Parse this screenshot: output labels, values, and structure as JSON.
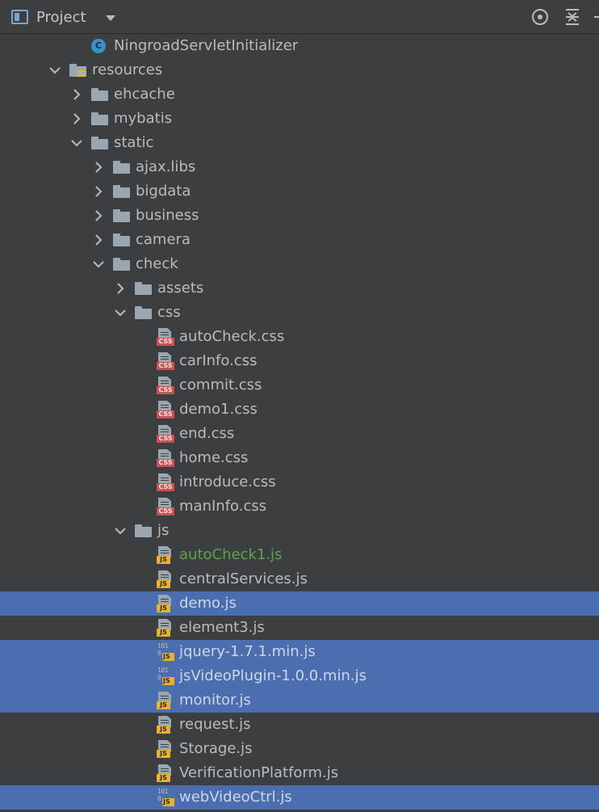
{
  "header": {
    "title": "Project",
    "locate_icon": "target-icon",
    "collapse_icon": "collapse-all-icon"
  },
  "tree": [
    {
      "label": "NingroadServletInitializer",
      "type": "class",
      "depth": 3,
      "expanded": null,
      "selected": false
    },
    {
      "label": "resources",
      "type": "resource-folder",
      "depth": 2,
      "expanded": true,
      "selected": false
    },
    {
      "label": "ehcache",
      "type": "folder",
      "depth": 3,
      "expanded": false,
      "selected": false
    },
    {
      "label": "mybatis",
      "type": "folder",
      "depth": 3,
      "expanded": false,
      "selected": false
    },
    {
      "label": "static",
      "type": "folder",
      "depth": 3,
      "expanded": true,
      "selected": false
    },
    {
      "label": "ajax.libs",
      "type": "folder",
      "depth": 4,
      "expanded": false,
      "selected": false
    },
    {
      "label": "bigdata",
      "type": "folder",
      "depth": 4,
      "expanded": false,
      "selected": false
    },
    {
      "label": "business",
      "type": "folder",
      "depth": 4,
      "expanded": false,
      "selected": false
    },
    {
      "label": "camera",
      "type": "folder",
      "depth": 4,
      "expanded": false,
      "selected": false
    },
    {
      "label": "check",
      "type": "folder",
      "depth": 4,
      "expanded": true,
      "selected": false
    },
    {
      "label": "assets",
      "type": "folder",
      "depth": 5,
      "expanded": false,
      "selected": false
    },
    {
      "label": "css",
      "type": "folder",
      "depth": 5,
      "expanded": true,
      "selected": false
    },
    {
      "label": "autoCheck.css",
      "type": "css",
      "depth": 6,
      "selected": false
    },
    {
      "label": "carInfo.css",
      "type": "css",
      "depth": 6,
      "selected": false
    },
    {
      "label": "commit.css",
      "type": "css",
      "depth": 6,
      "selected": false
    },
    {
      "label": "demo1.css",
      "type": "css",
      "depth": 6,
      "selected": false
    },
    {
      "label": "end.css",
      "type": "css",
      "depth": 6,
      "selected": false
    },
    {
      "label": "home.css",
      "type": "css",
      "depth": 6,
      "selected": false
    },
    {
      "label": "introduce.css",
      "type": "css",
      "depth": 6,
      "selected": false
    },
    {
      "label": "manInfo.css",
      "type": "css",
      "depth": 6,
      "selected": false
    },
    {
      "label": "js",
      "type": "folder",
      "depth": 5,
      "expanded": true,
      "selected": false
    },
    {
      "label": "autoCheck1.js",
      "type": "js",
      "depth": 6,
      "selected": false,
      "modified": true
    },
    {
      "label": "centralServices.js",
      "type": "js",
      "depth": 6,
      "selected": false
    },
    {
      "label": "demo.js",
      "type": "js",
      "depth": 6,
      "selected": true
    },
    {
      "label": "element3.js",
      "type": "js",
      "depth": 6,
      "selected": false
    },
    {
      "label": "jquery-1.7.1.min.js",
      "type": "min-js",
      "depth": 6,
      "selected": true
    },
    {
      "label": "jsVideoPlugin-1.0.0.min.js",
      "type": "min-js",
      "depth": 6,
      "selected": true
    },
    {
      "label": "monitor.js",
      "type": "js",
      "depth": 6,
      "selected": true
    },
    {
      "label": "request.js",
      "type": "js",
      "depth": 6,
      "selected": false
    },
    {
      "label": "Storage.js",
      "type": "js",
      "depth": 6,
      "selected": false
    },
    {
      "label": "VerificationPlatform.js",
      "type": "js",
      "depth": 6,
      "selected": false
    },
    {
      "label": "webVideoCtrl.js",
      "type": "min-js",
      "depth": 6,
      "selected": true
    }
  ],
  "colors": {
    "background": "#3c3f41",
    "selection": "#4b6eaf",
    "modified_text": "#62a248",
    "folder": "#9aa7b0",
    "css_badge": "#c75450",
    "js_badge": "#e8b22e",
    "class_icon": "#3592c4"
  }
}
